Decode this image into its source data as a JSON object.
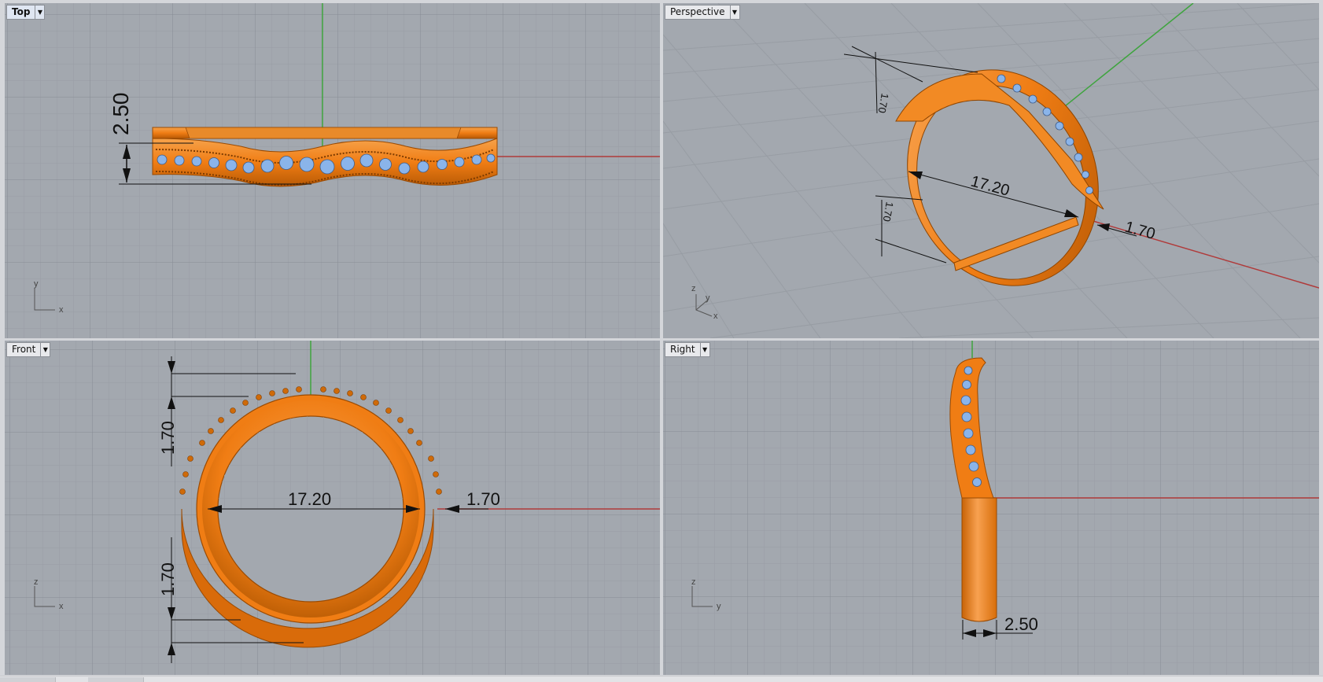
{
  "viewports": {
    "top": {
      "label": "Top",
      "active": true,
      "axes": {
        "h": "x",
        "v": "y"
      }
    },
    "perspective": {
      "label": "Perspective",
      "active": false,
      "axes": {
        "h": "x",
        "v": "y",
        "z": "z"
      }
    },
    "front": {
      "label": "Front",
      "active": false,
      "axes": {
        "h": "x",
        "v": "z"
      }
    },
    "right": {
      "label": "Right",
      "active": false,
      "axes": {
        "h": "y",
        "v": "z"
      }
    }
  },
  "dimensions": {
    "top_height": "2.50",
    "persp_diameter": "17.20",
    "persp_wall": "1.70",
    "persp_vert_a": "1.70",
    "persp_vert_b": "1.70",
    "front_diameter": "17.20",
    "front_wall": "1.70",
    "front_top": "1.70",
    "front_bottom": "1.70",
    "right_width": "2.50"
  },
  "colors": {
    "viewport_bg": "#a3a8af",
    "grid_minor": "#989da4",
    "grid_major": "#868b93",
    "axis_x": "#b03a3a",
    "axis_y": "#3fa43f",
    "ring_gold": "#f07d14",
    "stones": "#8ab4ea"
  },
  "icons": {
    "dropdown": "chevron-down-icon",
    "axis_widget": "axis-triad-icon"
  }
}
